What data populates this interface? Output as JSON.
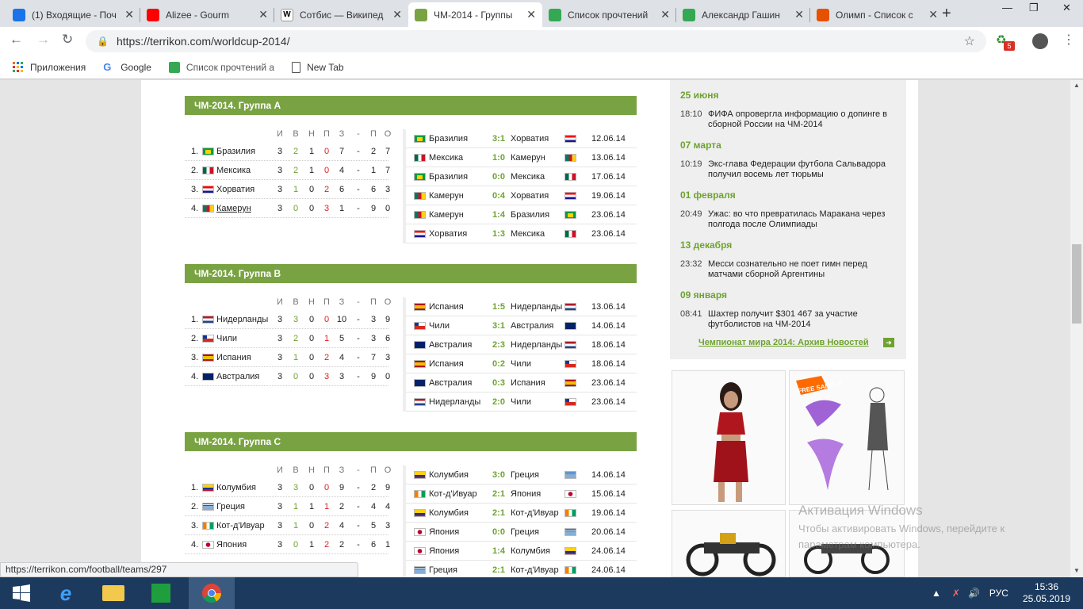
{
  "tabs": [
    {
      "title": "(1) Входящие - Поч",
      "icon": "mail-icon",
      "color": "#1a73e8"
    },
    {
      "title": "Alizee - Gourm",
      "icon": "youtube-icon",
      "color": "#ff0000"
    },
    {
      "title": "Сотбис — Википед",
      "icon": "wikipedia-icon",
      "color": "#ffffff"
    },
    {
      "title": "ЧМ-2014 - Группы",
      "icon": "terrikon-icon",
      "color": "#79a342"
    },
    {
      "title": "Список прочтений",
      "icon": "sheets-icon",
      "color": "#34a853"
    },
    {
      "title": "Александр Гашин",
      "icon": "sheets-icon",
      "color": "#34a853"
    },
    {
      "title": "Олимп - Список с",
      "icon": "olimp-icon",
      "color": "#e65100"
    }
  ],
  "address": {
    "url": "https://terrikon.com/worldcup-2014/"
  },
  "extension_badge": "5",
  "bookmarks": [
    {
      "label": "Приложения",
      "icon": "apps-grid-icon"
    },
    {
      "label": "Google",
      "icon": "google-icon"
    },
    {
      "label": "Список прочтений а",
      "icon": "sheets-icon"
    },
    {
      "label": "New Tab",
      "icon": "page-icon"
    }
  ],
  "standings_headers": [
    "И",
    "В",
    "Н",
    "П",
    "З",
    "-",
    "П",
    "О"
  ],
  "groups": [
    {
      "title": "ЧМ-2014. Группа A",
      "standings": [
        {
          "pos": "1.",
          "team": "Бразилия",
          "flag": "br",
          "i": "3",
          "w": "2",
          "d": "1",
          "l": "0",
          "gf": "7",
          "dash": "-",
          "ga": "2",
          "pts": "7"
        },
        {
          "pos": "2.",
          "team": "Мексика",
          "flag": "mx",
          "i": "3",
          "w": "2",
          "d": "1",
          "l": "0",
          "gf": "4",
          "dash": "-",
          "ga": "1",
          "pts": "7"
        },
        {
          "pos": "3.",
          "team": "Хорватия",
          "flag": "hr",
          "i": "3",
          "w": "1",
          "d": "0",
          "l": "2",
          "gf": "6",
          "dash": "-",
          "ga": "6",
          "pts": "3"
        },
        {
          "pos": "4.",
          "team": "Камерун",
          "flag": "cm",
          "i": "3",
          "w": "0",
          "d": "0",
          "l": "3",
          "gf": "1",
          "dash": "-",
          "ga": "9",
          "pts": "0",
          "link": true
        }
      ],
      "matches": [
        {
          "t1": "Бразилия",
          "f1": "br",
          "score": "3:1",
          "t2": "Хорватия",
          "f2": "hr",
          "date": "12.06.14"
        },
        {
          "t1": "Мексика",
          "f1": "mx",
          "score": "1:0",
          "t2": "Камерун",
          "f2": "cm",
          "date": "13.06.14"
        },
        {
          "t1": "Бразилия",
          "f1": "br",
          "score": "0:0",
          "t2": "Мексика",
          "f2": "mx",
          "date": "17.06.14"
        },
        {
          "t1": "Камерун",
          "f1": "cm",
          "score": "0:4",
          "t2": "Хорватия",
          "f2": "hr",
          "date": "19.06.14"
        },
        {
          "t1": "Камерун",
          "f1": "cm",
          "score": "1:4",
          "t2": "Бразилия",
          "f2": "br",
          "date": "23.06.14"
        },
        {
          "t1": "Хорватия",
          "f1": "hr",
          "score": "1:3",
          "t2": "Мексика",
          "f2": "mx",
          "date": "23.06.14"
        }
      ]
    },
    {
      "title": "ЧМ-2014. Группа B",
      "standings": [
        {
          "pos": "1.",
          "team": "Нидерланды",
          "flag": "nl",
          "i": "3",
          "w": "3",
          "d": "0",
          "l": "0",
          "gf": "10",
          "dash": "-",
          "ga": "3",
          "pts": "9"
        },
        {
          "pos": "2.",
          "team": "Чили",
          "flag": "cl",
          "i": "3",
          "w": "2",
          "d": "0",
          "l": "1",
          "gf": "5",
          "dash": "-",
          "ga": "3",
          "pts": "6"
        },
        {
          "pos": "3.",
          "team": "Испания",
          "flag": "es",
          "i": "3",
          "w": "1",
          "d": "0",
          "l": "2",
          "gf": "4",
          "dash": "-",
          "ga": "7",
          "pts": "3"
        },
        {
          "pos": "4.",
          "team": "Австралия",
          "flag": "au",
          "i": "3",
          "w": "0",
          "d": "0",
          "l": "3",
          "gf": "3",
          "dash": "-",
          "ga": "9",
          "pts": "0"
        }
      ],
      "matches": [
        {
          "t1": "Испания",
          "f1": "es",
          "score": "1:5",
          "t2": "Нидерланды",
          "f2": "nl",
          "date": "13.06.14"
        },
        {
          "t1": "Чили",
          "f1": "cl",
          "score": "3:1",
          "t2": "Австралия",
          "f2": "au",
          "date": "14.06.14"
        },
        {
          "t1": "Австралия",
          "f1": "au",
          "score": "2:3",
          "t2": "Нидерланды",
          "f2": "nl",
          "date": "18.06.14"
        },
        {
          "t1": "Испания",
          "f1": "es",
          "score": "0:2",
          "t2": "Чили",
          "f2": "cl",
          "date": "18.06.14"
        },
        {
          "t1": "Австралия",
          "f1": "au",
          "score": "0:3",
          "t2": "Испания",
          "f2": "es",
          "date": "23.06.14"
        },
        {
          "t1": "Нидерланды",
          "f1": "nl",
          "score": "2:0",
          "t2": "Чили",
          "f2": "cl",
          "date": "23.06.14"
        }
      ]
    },
    {
      "title": "ЧМ-2014. Группа C",
      "standings": [
        {
          "pos": "1.",
          "team": "Колумбия",
          "flag": "co",
          "i": "3",
          "w": "3",
          "d": "0",
          "l": "0",
          "gf": "9",
          "dash": "-",
          "ga": "2",
          "pts": "9"
        },
        {
          "pos": "2.",
          "team": "Греция",
          "flag": "gr",
          "i": "3",
          "w": "1",
          "d": "1",
          "l": "1",
          "gf": "2",
          "dash": "-",
          "ga": "4",
          "pts": "4"
        },
        {
          "pos": "3.",
          "team": "Кот-д'Ивуар",
          "flag": "ci",
          "i": "3",
          "w": "1",
          "d": "0",
          "l": "2",
          "gf": "4",
          "dash": "-",
          "ga": "5",
          "pts": "3"
        },
        {
          "pos": "4.",
          "team": "Япония",
          "flag": "jp",
          "i": "3",
          "w": "0",
          "d": "1",
          "l": "2",
          "gf": "2",
          "dash": "-",
          "ga": "6",
          "pts": "1"
        }
      ],
      "matches": [
        {
          "t1": "Колумбия",
          "f1": "co",
          "score": "3:0",
          "t2": "Греция",
          "f2": "gr",
          "date": "14.06.14"
        },
        {
          "t1": "Кот-д'Ивуар",
          "f1": "ci",
          "score": "2:1",
          "t2": "Япония",
          "f2": "jp",
          "date": "15.06.14"
        },
        {
          "t1": "Колумбия",
          "f1": "co",
          "score": "2:1",
          "t2": "Кот-д'Ивуар",
          "f2": "ci",
          "date": "19.06.14"
        },
        {
          "t1": "Япония",
          "f1": "jp",
          "score": "0:0",
          "t2": "Греция",
          "f2": "gr",
          "date": "20.06.14"
        },
        {
          "t1": "Япония",
          "f1": "jp",
          "score": "1:4",
          "t2": "Колумбия",
          "f2": "co",
          "date": "24.06.14"
        },
        {
          "t1": "Греция",
          "f1": "gr",
          "score": "2:1",
          "t2": "Кот-д'Ивуар",
          "f2": "ci",
          "date": "24.06.14"
        }
      ]
    }
  ],
  "news": [
    {
      "date": "25 июня",
      "time": "18:10",
      "text": "ФИФА опровергла информацию о допинге в сборной России на ЧМ-2014"
    },
    {
      "date": "07 марта",
      "time": "10:19",
      "text": "Экс-глава Федерации футбола Сальвадора получил восемь лет тюрьмы"
    },
    {
      "date": "01 февраля",
      "time": "20:49",
      "text": "Ужас: во что превратилась Маракана через полгода после Олимпиады"
    },
    {
      "date": "13 декабря",
      "time": "23:32",
      "text": "Месси сознательно не поет гимн перед матчами сборной Аргентины"
    },
    {
      "date": "09 января",
      "time": "08:41",
      "text": "Шахтер получит $301 467 за участие футболистов на ЧМ-2014"
    }
  ],
  "archive_link": "Чемпионат мира 2014: Архив Новостей",
  "ad": {
    "sample_label": "FREE SAMPLE"
  },
  "watermark": {
    "title": "Активация Windows",
    "text": "Чтобы активировать Windows, перейдите к параметрам компьютера."
  },
  "status_url": "https://terrikon.com/football/teams/297",
  "tray": {
    "lang": "РУС",
    "time": "15:36",
    "date": "25.05.2019"
  },
  "colors": {
    "accent": "#79a342",
    "win_text": "#6ea22f",
    "loss_text": "#dd2222"
  }
}
